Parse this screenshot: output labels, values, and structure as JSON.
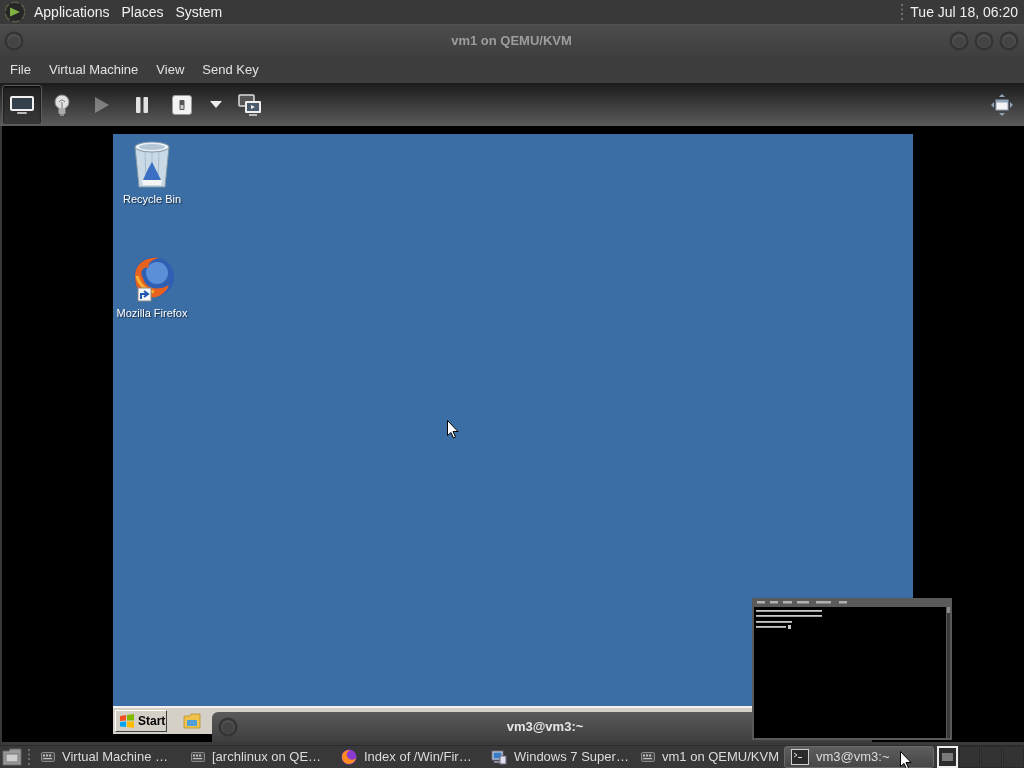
{
  "top_panel": {
    "menus": [
      "Applications",
      "Places",
      "System"
    ],
    "clock": "Tue Jul 18, 06:20"
  },
  "window": {
    "title": "vm1 on QEMU/KVM",
    "menus": [
      "File",
      "Virtual Machine",
      "View",
      "Send Key"
    ],
    "toolbar": [
      {
        "kind": "console",
        "selected": true,
        "disabled": false
      },
      {
        "kind": "details",
        "selected": false,
        "disabled": false
      },
      {
        "kind": "run",
        "selected": false,
        "disabled": true
      },
      {
        "kind": "pause",
        "selected": false,
        "disabled": false
      },
      {
        "kind": "shutdown",
        "selected": false,
        "disabled": false
      },
      {
        "kind": "menu",
        "selected": false,
        "disabled": false
      },
      {
        "kind": "snapshots",
        "selected": false,
        "disabled": false
      },
      {
        "kind": "fullscreen",
        "selected": false,
        "disabled": false
      }
    ]
  },
  "guest": {
    "desktop_icons": [
      {
        "kind": "trash",
        "label": "Recycle Bin"
      },
      {
        "kind": "browser",
        "label": "Mozilla Firefox"
      }
    ],
    "start_label": "Start"
  },
  "overlapping_window": {
    "title": "vm3@vm3:~"
  },
  "bottom_taskbar": {
    "items": [
      {
        "kind": "vm",
        "label": "Virtual Machine …",
        "selected": false
      },
      {
        "kind": "vm",
        "label": "[archlinux on QE…",
        "selected": false
      },
      {
        "kind": "browser",
        "label": "Index of /Win/Fir…",
        "selected": false
      },
      {
        "kind": "computer",
        "label": "Windows 7 Super…",
        "selected": false
      },
      {
        "kind": "vm",
        "label": "vm1 on QEMU/KVM",
        "selected": false
      },
      {
        "kind": "terminal",
        "label": "vm3@vm3:~",
        "selected": true
      }
    ],
    "workspaces": [
      {
        "selected": true
      },
      {
        "selected": false
      },
      {
        "selected": false
      },
      {
        "selected": false
      }
    ]
  }
}
